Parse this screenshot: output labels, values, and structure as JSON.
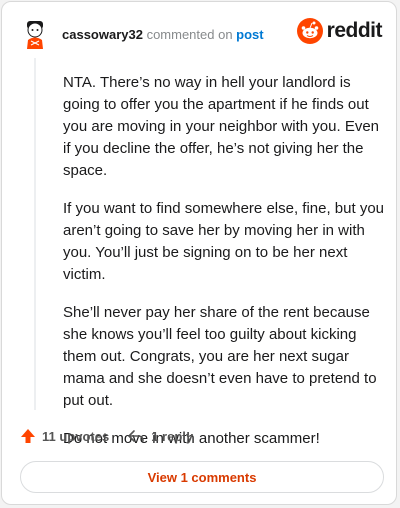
{
  "header": {
    "username": "cassowary32",
    "action_text": " commented on ",
    "post_link": "post",
    "brand": "reddit"
  },
  "comment": {
    "paragraphs": [
      "NTA. There’s no way in hell your landlord is going to offer you the apartment if he finds out you are moving in your neighbor with you. Even if you decline the offer, he’s not giving her the space.",
      "If you want to find somewhere else, fine, but you aren’t going to save her by moving her in with you. You’ll just be signing on to be her next victim.",
      "She’ll never pay her share of the rent because she knows you’ll feel too guilty about kicking them out. Congrats, you are her next sugar mama and she doesn’t even have to pretend to put out.",
      "Do not move in with another scammer!"
    ]
  },
  "actions": {
    "upvotes_label": "11 upvotes",
    "reply_label": "1 reply"
  },
  "footer": {
    "view_comments_label": "View 1 comments"
  },
  "colors": {
    "upvote": "#ff4500",
    "link": "#0079d3",
    "view_comments": "#d93a00"
  }
}
